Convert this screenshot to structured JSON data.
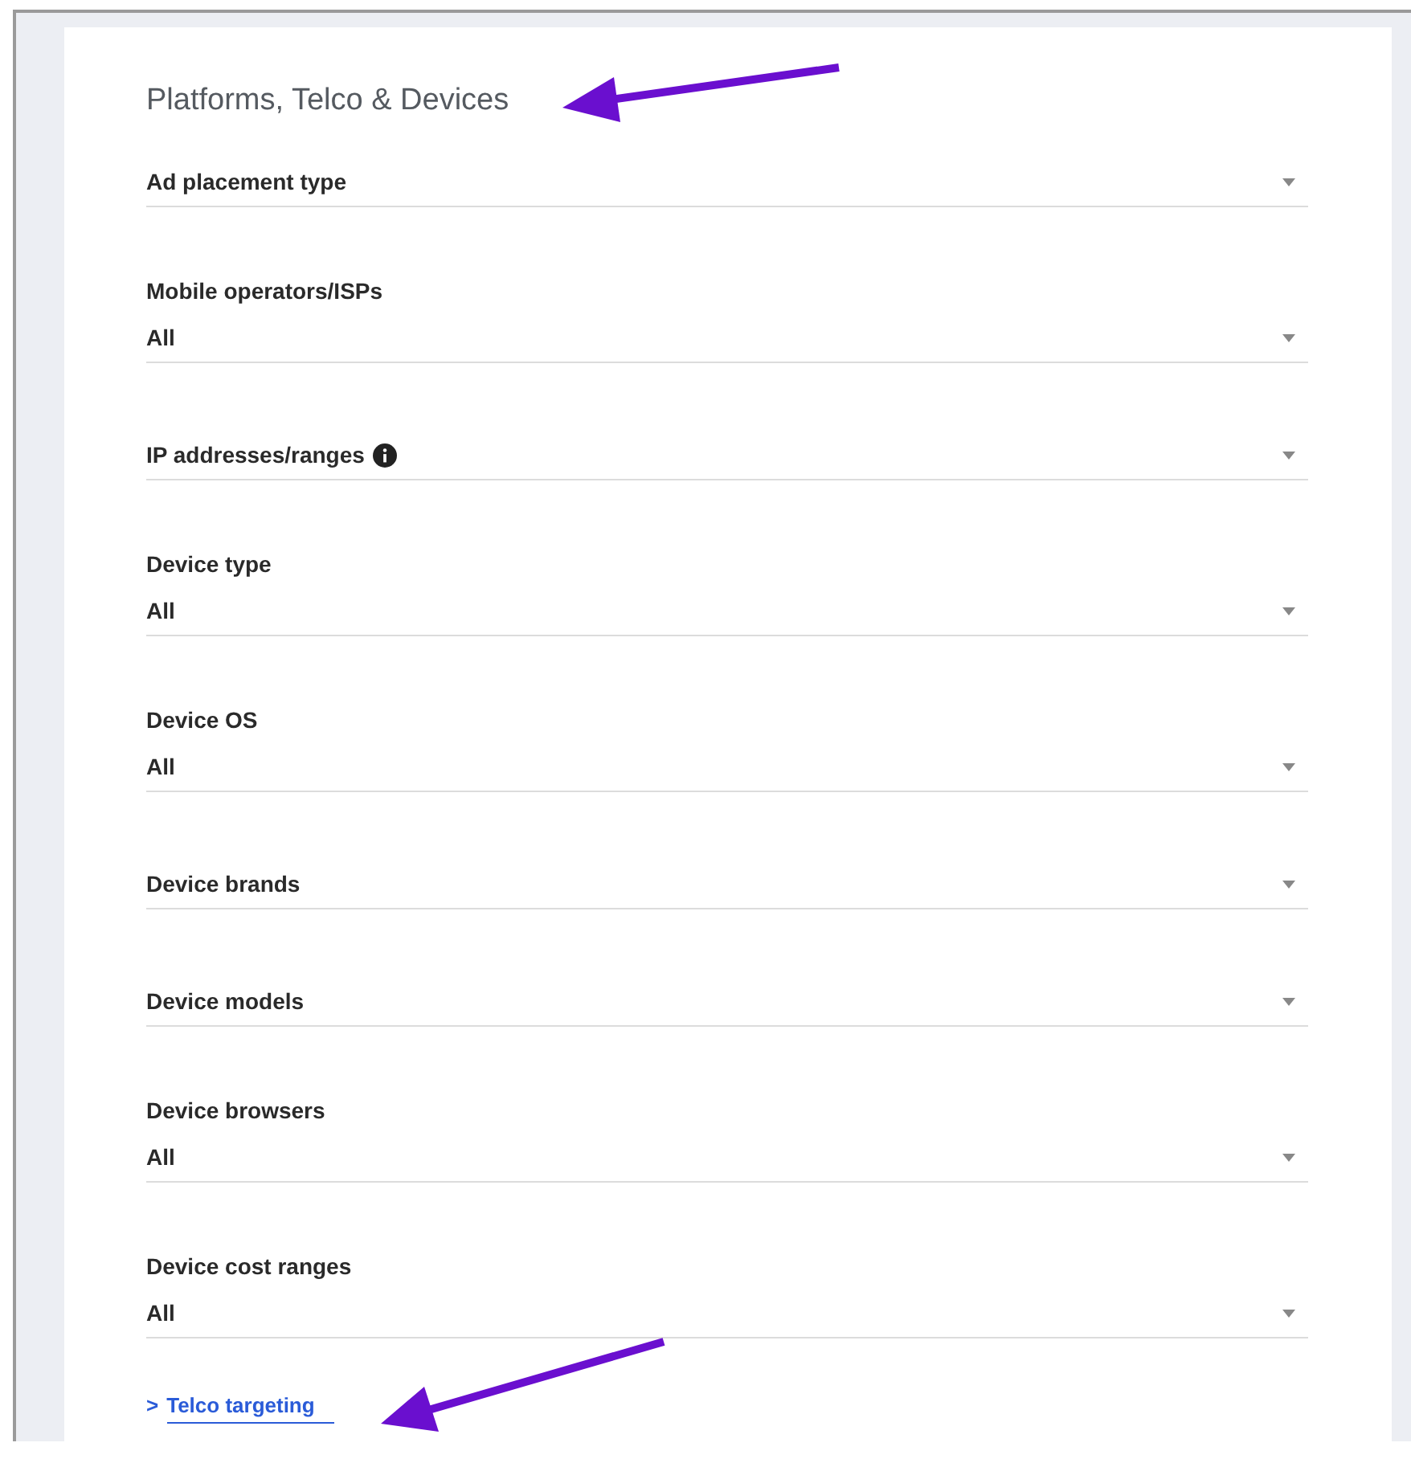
{
  "section": {
    "title": "Platforms, Telco & Devices"
  },
  "fields": [
    {
      "label": "Ad placement type",
      "info": false
    },
    {
      "label": "Mobile operators/ISPs",
      "value": "All",
      "info": false
    },
    {
      "label": "IP addresses/ranges",
      "info": true
    },
    {
      "label": "Device type",
      "value": "All",
      "info": false
    },
    {
      "label": "Device OS",
      "value": "All",
      "info": false
    },
    {
      "label": "Device brands",
      "info": false
    },
    {
      "label": "Device models",
      "info": false
    },
    {
      "label": "Device browsers",
      "value": "All",
      "info": false
    },
    {
      "label": "Device cost ranges",
      "value": "All",
      "info": false
    }
  ],
  "link": {
    "prefix": ">",
    "label": "Telco targeting"
  }
}
